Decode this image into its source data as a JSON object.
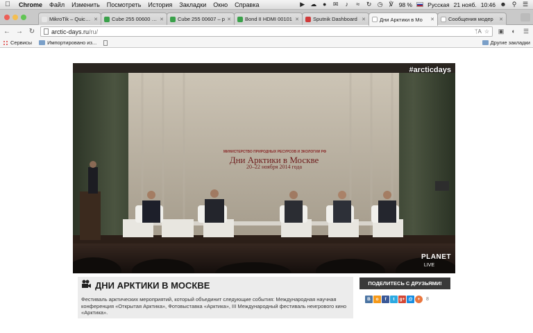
{
  "menubar": {
    "app": "Chrome",
    "items": [
      "Файл",
      "Изменить",
      "Посмотреть",
      "История",
      "Закладки",
      "Окно",
      "Справка"
    ],
    "battery": "98 %",
    "language": "Русская",
    "date": "21 нояб.",
    "time": "10:46"
  },
  "tabs": [
    {
      "label": "MikroTik – Quick Se",
      "favicon_color": "#e6e6e6"
    },
    {
      "label": "Cube 255 00600 – p",
      "favicon_color": "#3aa14a"
    },
    {
      "label": "Cube 255 00607 – p",
      "favicon_color": "#3aa14a"
    },
    {
      "label": "Bond II HDMI 00101",
      "favicon_color": "#3aa14a"
    },
    {
      "label": "Sputnik Dashboard",
      "favicon_color": "#d03a3a"
    },
    {
      "label": "Дни Арктики в Мо",
      "favicon_color": "#ffffff",
      "active": true
    },
    {
      "label": "Сообщения модер",
      "favicon_color": "#ffffff"
    }
  ],
  "address": {
    "host": "arctic-days.ru",
    "path": "/ru/"
  },
  "bookmarks": {
    "apps": "Сервисы",
    "imported": "Импортировано из...",
    "other": "Другие закладки"
  },
  "video": {
    "hashtag": "#arcticdays",
    "banner_org": "МИНИСТЕРСТВО ПРИРОДНЫХ РЕСУРСОВ И ЭКОЛОГИИ РФ",
    "banner_title": "Дни Арктики в Москве",
    "banner_date": "20–22 ноября 2014 года",
    "brand": "PLANET",
    "live": "LIVE"
  },
  "event": {
    "title": "ДНИ АРКТИКИ В МОСКВЕ",
    "description": "Фестиваль арктических мероприятий, который объединит следующие события: Международная научная конференция «Открытая Арктика», Фотовыставка «Арктика», III Международный фестиваль неигрового кино «Арктика»."
  },
  "share": {
    "label": "ПОДЕЛИТЕСЬ С ДРУЗЬЯМИ!",
    "count": "8",
    "networks": [
      {
        "name": "vk",
        "glyph": "В",
        "color": "#4c75a3"
      },
      {
        "name": "odnoklassniki",
        "glyph": "о",
        "color": "#f59a1b"
      },
      {
        "name": "facebook",
        "glyph": "f",
        "color": "#3b5998"
      },
      {
        "name": "twitter",
        "glyph": "t",
        "color": "#2ca9e1"
      },
      {
        "name": "google-plus",
        "glyph": "g+",
        "color": "#d34836"
      },
      {
        "name": "mail-ru",
        "glyph": "@",
        "color": "#168de2"
      },
      {
        "name": "livejournal",
        "glyph": "+",
        "color": "#e9763d"
      }
    ]
  }
}
